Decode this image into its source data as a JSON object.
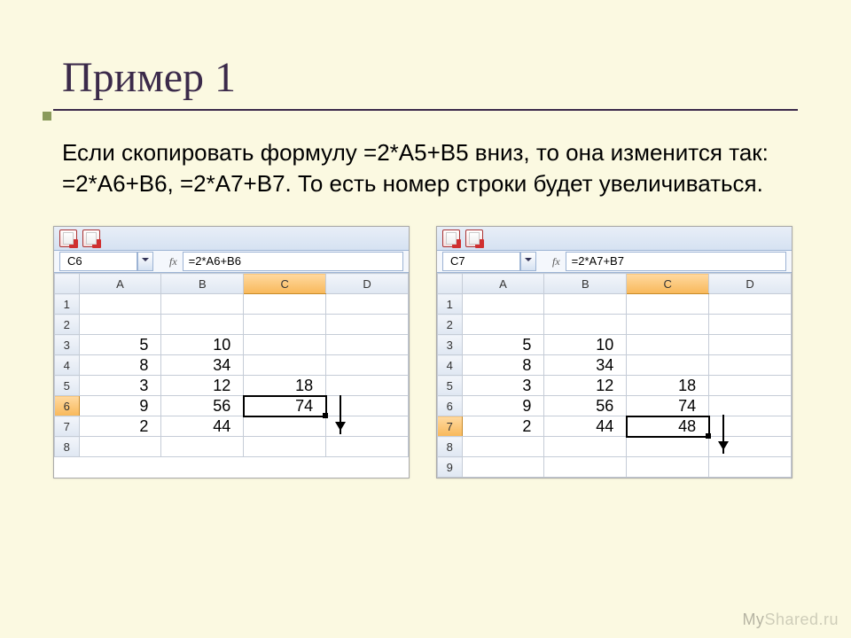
{
  "title": "Пример 1",
  "paragraph": "Если скопировать формулу =2*А5+В5 вниз, то она изменится так: =2*А6+В6, =2*А7+В7. То есть номер строки будет увеличиваться.",
  "watermark_left": "My",
  "watermark_right": "Shared.ru",
  "left": {
    "namebox": "C6",
    "fx_label": "fx",
    "formula": "=2*A6+B6",
    "cols": [
      "A",
      "B",
      "C",
      "D"
    ],
    "selected_col": "C",
    "selected_row": "6",
    "rows": [
      "1",
      "2",
      "3",
      "4",
      "5",
      "6",
      "7",
      "8"
    ],
    "cells": {
      "A3": "5",
      "B3": "10",
      "A4": "8",
      "B4": "34",
      "A5": "3",
      "B5": "12",
      "C5": "18",
      "A6": "9",
      "B6": "56",
      "C6": "74",
      "A7": "2",
      "B7": "44"
    }
  },
  "right": {
    "namebox": "C7",
    "fx_label": "fx",
    "formula": "=2*A7+B7",
    "cols": [
      "A",
      "B",
      "C",
      "D"
    ],
    "selected_col": "C",
    "selected_row": "7",
    "rows": [
      "1",
      "2",
      "3",
      "4",
      "5",
      "6",
      "7",
      "8",
      "9"
    ],
    "cells": {
      "A3": "5",
      "B3": "10",
      "A4": "8",
      "B4": "34",
      "A5": "3",
      "B5": "12",
      "C5": "18",
      "A6": "9",
      "B6": "56",
      "C6": "74",
      "A7": "2",
      "B7": "44",
      "C7": "48"
    }
  }
}
